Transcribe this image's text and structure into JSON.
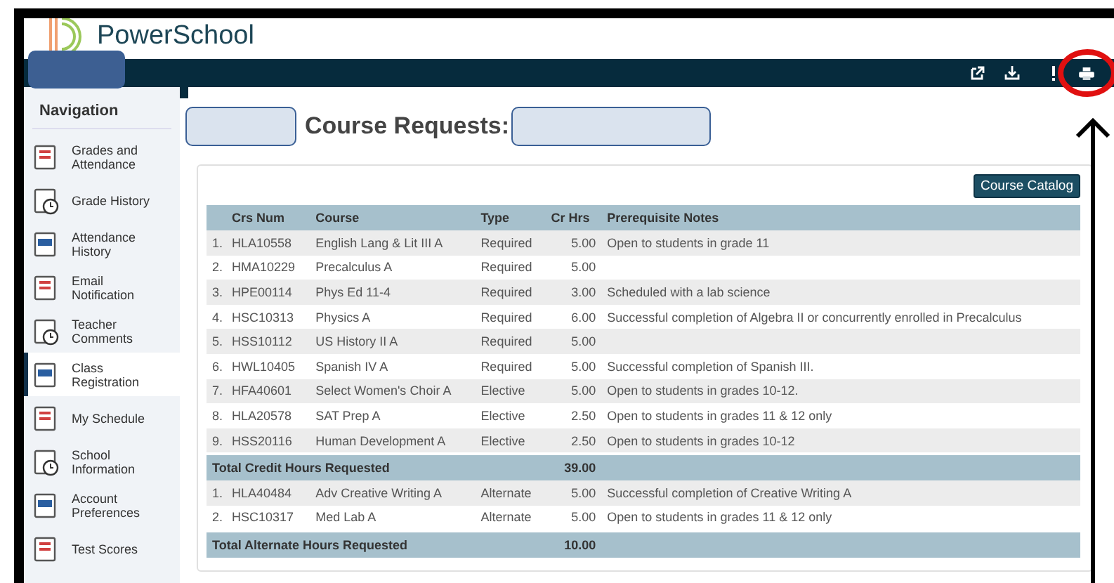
{
  "header": {
    "logo_text": "PowerSchool"
  },
  "sidebar": {
    "title": "Navigation",
    "items": [
      {
        "label": "Grades and Attendance",
        "selected": false
      },
      {
        "label": "Grade History",
        "selected": false
      },
      {
        "label": "Attendance History",
        "selected": false
      },
      {
        "label": "Email Notification",
        "selected": false
      },
      {
        "label": "Teacher Comments",
        "selected": false
      },
      {
        "label": "Class Registration",
        "selected": true
      },
      {
        "label": "My Schedule",
        "selected": false
      },
      {
        "label": "School Information",
        "selected": false
      },
      {
        "label": "Account Preferences",
        "selected": false
      },
      {
        "label": "Test Scores",
        "selected": false
      }
    ]
  },
  "page": {
    "title": "Course Requests:",
    "catalog_button": "Course Catalog"
  },
  "table": {
    "columns": [
      "Crs Num",
      "Course",
      "Type",
      "Cr Hrs",
      "Prerequisite Notes"
    ],
    "rows": [
      {
        "kind": "course",
        "num": "1.",
        "code": "HLA10558",
        "course": "English Lang & Lit III A",
        "type": "Required",
        "hrs": "5.00",
        "note": "Open to students in grade 11"
      },
      {
        "kind": "course",
        "num": "2.",
        "code": "HMA10229",
        "course": "Precalculus A",
        "type": "Required",
        "hrs": "5.00",
        "note": ""
      },
      {
        "kind": "course",
        "num": "3.",
        "code": "HPE00114",
        "course": "Phys Ed 11-4",
        "type": "Required",
        "hrs": "3.00",
        "note": "Scheduled with a lab science"
      },
      {
        "kind": "course",
        "num": "4.",
        "code": "HSC10313",
        "course": "Physics A",
        "type": "Required",
        "hrs": "6.00",
        "note": "Successful completion of Algebra II or concurrently enrolled in Precalculus"
      },
      {
        "kind": "course",
        "num": "5.",
        "code": "HSS10112",
        "course": "US History II A",
        "type": "Required",
        "hrs": "5.00",
        "note": ""
      },
      {
        "kind": "course",
        "num": "6.",
        "code": "HWL10405",
        "course": "Spanish IV A",
        "type": "Required",
        "hrs": "5.00",
        "note": "Successful completion of Spanish III."
      },
      {
        "kind": "course",
        "num": "7.",
        "code": "HFA40601",
        "course": "Select Women's Choir A",
        "type": "Elective",
        "hrs": "5.00",
        "note": "Open to students in grades 10-12."
      },
      {
        "kind": "course",
        "num": "8.",
        "code": "HLA20578",
        "course": "SAT Prep A",
        "type": "Elective",
        "hrs": "2.50",
        "note": "Open to students in grades 11 & 12 only"
      },
      {
        "kind": "course",
        "num": "9.",
        "code": "HSS20116",
        "course": "Human Development A",
        "type": "Elective",
        "hrs": "2.50",
        "note": "Open to students in grades 10-12"
      },
      {
        "kind": "total",
        "label": "Total Credit Hours Requested",
        "hrs": "39.00"
      },
      {
        "kind": "course",
        "num": "1.",
        "code": "HLA40484",
        "course": "Adv Creative Writing A",
        "type": "Alternate",
        "hrs": "5.00",
        "note": "Successful completion of Creative Writing A"
      },
      {
        "kind": "course",
        "num": "2.",
        "code": "HSC10317",
        "course": "Med Lab A",
        "type": "Alternate",
        "hrs": "5.00",
        "note": "Open to students in grades 11 & 12 only"
      },
      {
        "kind": "total",
        "label": "Total Alternate Hours Requested",
        "hrs": "10.00"
      }
    ]
  }
}
